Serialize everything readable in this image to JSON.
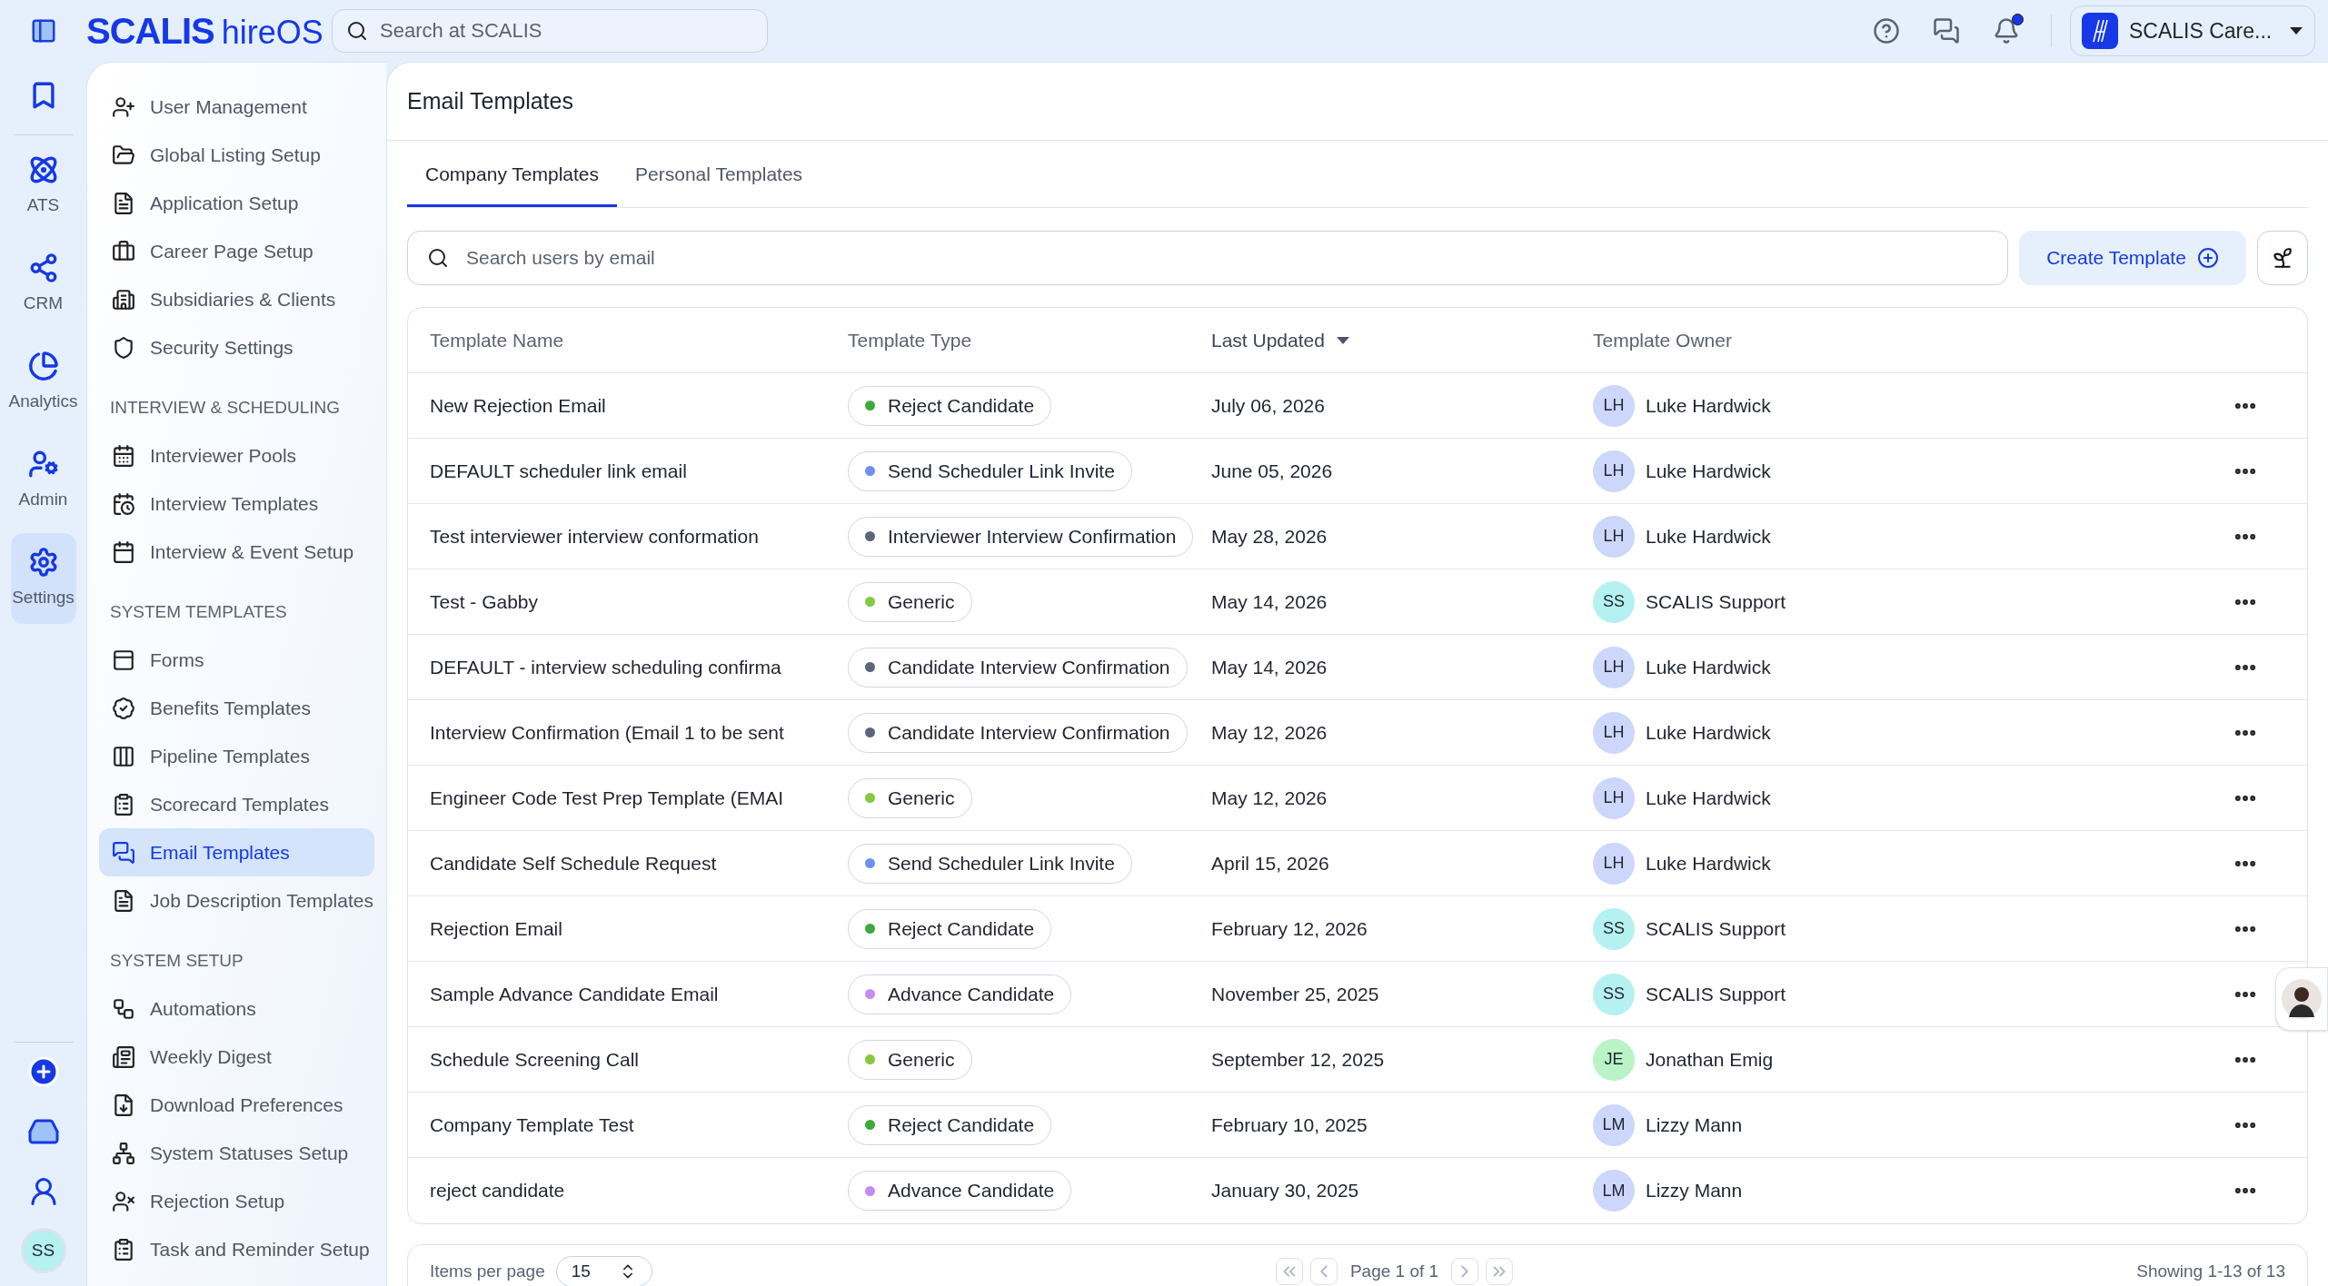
{
  "top_bar": {
    "brand": "SCALIS",
    "product": "hireOS",
    "search": {
      "placeholder": "Search at SCALIS"
    },
    "notifications": {
      "unread": true
    },
    "account": {
      "name": "SCALIS Care..."
    }
  },
  "rail": {
    "items": [
      {
        "selected": false
      },
      {
        "label": "ATS",
        "selected": false
      },
      {
        "label": "CRM",
        "selected": false
      },
      {
        "label": "Analytics",
        "selected": false
      },
      {
        "label": "Admin",
        "selected": false
      },
      {
        "label": "Settings",
        "selected": true
      }
    ],
    "user": {
      "initials": "SS"
    }
  },
  "sidebar": {
    "sections": [
      {
        "items": [
          {
            "label": "User Management",
            "selected": false
          },
          {
            "label": "Global Listing Setup",
            "selected": false
          },
          {
            "label": "Application Setup",
            "selected": false
          },
          {
            "label": "Career Page Setup",
            "selected": false
          },
          {
            "label": "Subsidiaries & Clients",
            "selected": false
          },
          {
            "label": "Security Settings",
            "selected": false
          }
        ]
      },
      {
        "heading": "INTERVIEW & SCHEDULING",
        "items": [
          {
            "label": "Interviewer Pools",
            "selected": false
          },
          {
            "label": "Interview Templates",
            "selected": false
          },
          {
            "label": "Interview & Event Setup",
            "selected": false
          }
        ]
      },
      {
        "heading": "SYSTEM TEMPLATES",
        "items": [
          {
            "label": "Forms",
            "selected": false
          },
          {
            "label": "Benefits Templates",
            "selected": false
          },
          {
            "label": "Pipeline Templates",
            "selected": false
          },
          {
            "label": "Scorecard Templates",
            "selected": false
          },
          {
            "label": "Email Templates",
            "selected": true
          },
          {
            "label": "Job Description Templates",
            "selected": false
          }
        ]
      },
      {
        "heading": "SYSTEM SETUP",
        "items": [
          {
            "label": "Automations",
            "selected": false
          },
          {
            "label": "Weekly Digest",
            "selected": false
          },
          {
            "label": "Download Preferences",
            "selected": false
          },
          {
            "label": "System Statuses Setup",
            "selected": false
          },
          {
            "label": "Rejection Setup",
            "selected": false
          },
          {
            "label": "Task and Reminder Setup",
            "selected": false
          }
        ]
      }
    ]
  },
  "page": {
    "title": "Email Templates",
    "tabs": [
      {
        "label": "Company Templates",
        "selected": true
      },
      {
        "label": "Personal Templates",
        "selected": false
      }
    ],
    "search": {
      "placeholder": "Search users by email"
    },
    "create_button": "Create Template",
    "table": {
      "columns": [
        {
          "label": "Template Name",
          "sorted": false
        },
        {
          "label": "Template Type",
          "sorted": false
        },
        {
          "label": "Last Updated",
          "sorted": true
        },
        {
          "label": "Template Owner",
          "sorted": false
        }
      ],
      "rows": [
        {
          "name": "New Rejection Email",
          "type": {
            "label": "Reject Candidate",
            "color": "#3daa3d"
          },
          "updated": "July 06, 2026",
          "owner": {
            "initials": "LH",
            "name": "Luke Hardwick",
            "color": "#cdd6fb"
          }
        },
        {
          "name": "DEFAULT scheduler link email",
          "type": {
            "label": "Send Scheduler Link Invite",
            "color": "#6f8ff5"
          },
          "updated": "June 05, 2026",
          "owner": {
            "initials": "LH",
            "name": "Luke Hardwick",
            "color": "#cdd6fb"
          }
        },
        {
          "name": "Test interviewer interview conformation",
          "type": {
            "label": "Interviewer Interview Confirmation",
            "color": "#5d6679"
          },
          "updated": "May 28, 2026",
          "owner": {
            "initials": "LH",
            "name": "Luke Hardwick",
            "color": "#cdd6fb"
          }
        },
        {
          "name": "Test - Gabby",
          "type": {
            "label": "Generic",
            "color": "#86c940"
          },
          "updated": "May 14, 2026",
          "owner": {
            "initials": "SS",
            "name": "SCALIS Support",
            "color": "#b5f1f0"
          }
        },
        {
          "name": "DEFAULT - interview scheduling confirma",
          "type": {
            "label": "Candidate Interview Confirmation",
            "color": "#5d6679"
          },
          "updated": "May 14, 2026",
          "owner": {
            "initials": "LH",
            "name": "Luke Hardwick",
            "color": "#cdd6fb"
          }
        },
        {
          "name": "Interview Confirmation (Email 1 to be sent",
          "type": {
            "label": "Candidate Interview Confirmation",
            "color": "#5d6679"
          },
          "updated": "May 12, 2026",
          "owner": {
            "initials": "LH",
            "name": "Luke Hardwick",
            "color": "#cdd6fb"
          }
        },
        {
          "name": "Engineer Code Test Prep Template (EMAI",
          "type": {
            "label": "Generic",
            "color": "#86c940"
          },
          "updated": "May 12, 2026",
          "owner": {
            "initials": "LH",
            "name": "Luke Hardwick",
            "color": "#cdd6fb"
          }
        },
        {
          "name": "Candidate Self Schedule Request",
          "type": {
            "label": "Send Scheduler Link Invite",
            "color": "#6f8ff5"
          },
          "updated": "April 15, 2026",
          "owner": {
            "initials": "LH",
            "name": "Luke Hardwick",
            "color": "#cdd6fb"
          }
        },
        {
          "name": "Rejection Email",
          "type": {
            "label": "Reject Candidate",
            "color": "#3daa3d"
          },
          "updated": "February 12, 2026",
          "owner": {
            "initials": "SS",
            "name": "SCALIS Support",
            "color": "#b5f1f0"
          }
        },
        {
          "name": "Sample Advance Candidate Email",
          "type": {
            "label": "Advance Candidate",
            "color": "#c38cf5"
          },
          "updated": "November 25, 2025",
          "owner": {
            "initials": "SS",
            "name": "SCALIS Support",
            "color": "#b5f1f0"
          }
        },
        {
          "name": "Schedule Screening Call",
          "type": {
            "label": "Generic",
            "color": "#86c940"
          },
          "updated": "September 12, 2025",
          "owner": {
            "initials": "JE",
            "name": "Jonathan Emig",
            "color": "#b9f3c6"
          }
        },
        {
          "name": "Company Template Test",
          "type": {
            "label": "Reject Candidate",
            "color": "#3daa3d"
          },
          "updated": "February 10, 2025",
          "owner": {
            "initials": "LM",
            "name": "Lizzy Mann",
            "color": "#cdd6fb"
          }
        },
        {
          "name": "reject candidate",
          "type": {
            "label": "Advance Candidate",
            "color": "#c38cf5"
          },
          "updated": "January 30, 2025",
          "owner": {
            "initials": "LM",
            "name": "Lizzy Mann",
            "color": "#cdd6fb"
          }
        }
      ]
    },
    "pagination": {
      "items_label": "Items per page",
      "per_page": "15",
      "page": "Page 1 of 1",
      "showing": "Showing 1-13 of 13"
    }
  }
}
